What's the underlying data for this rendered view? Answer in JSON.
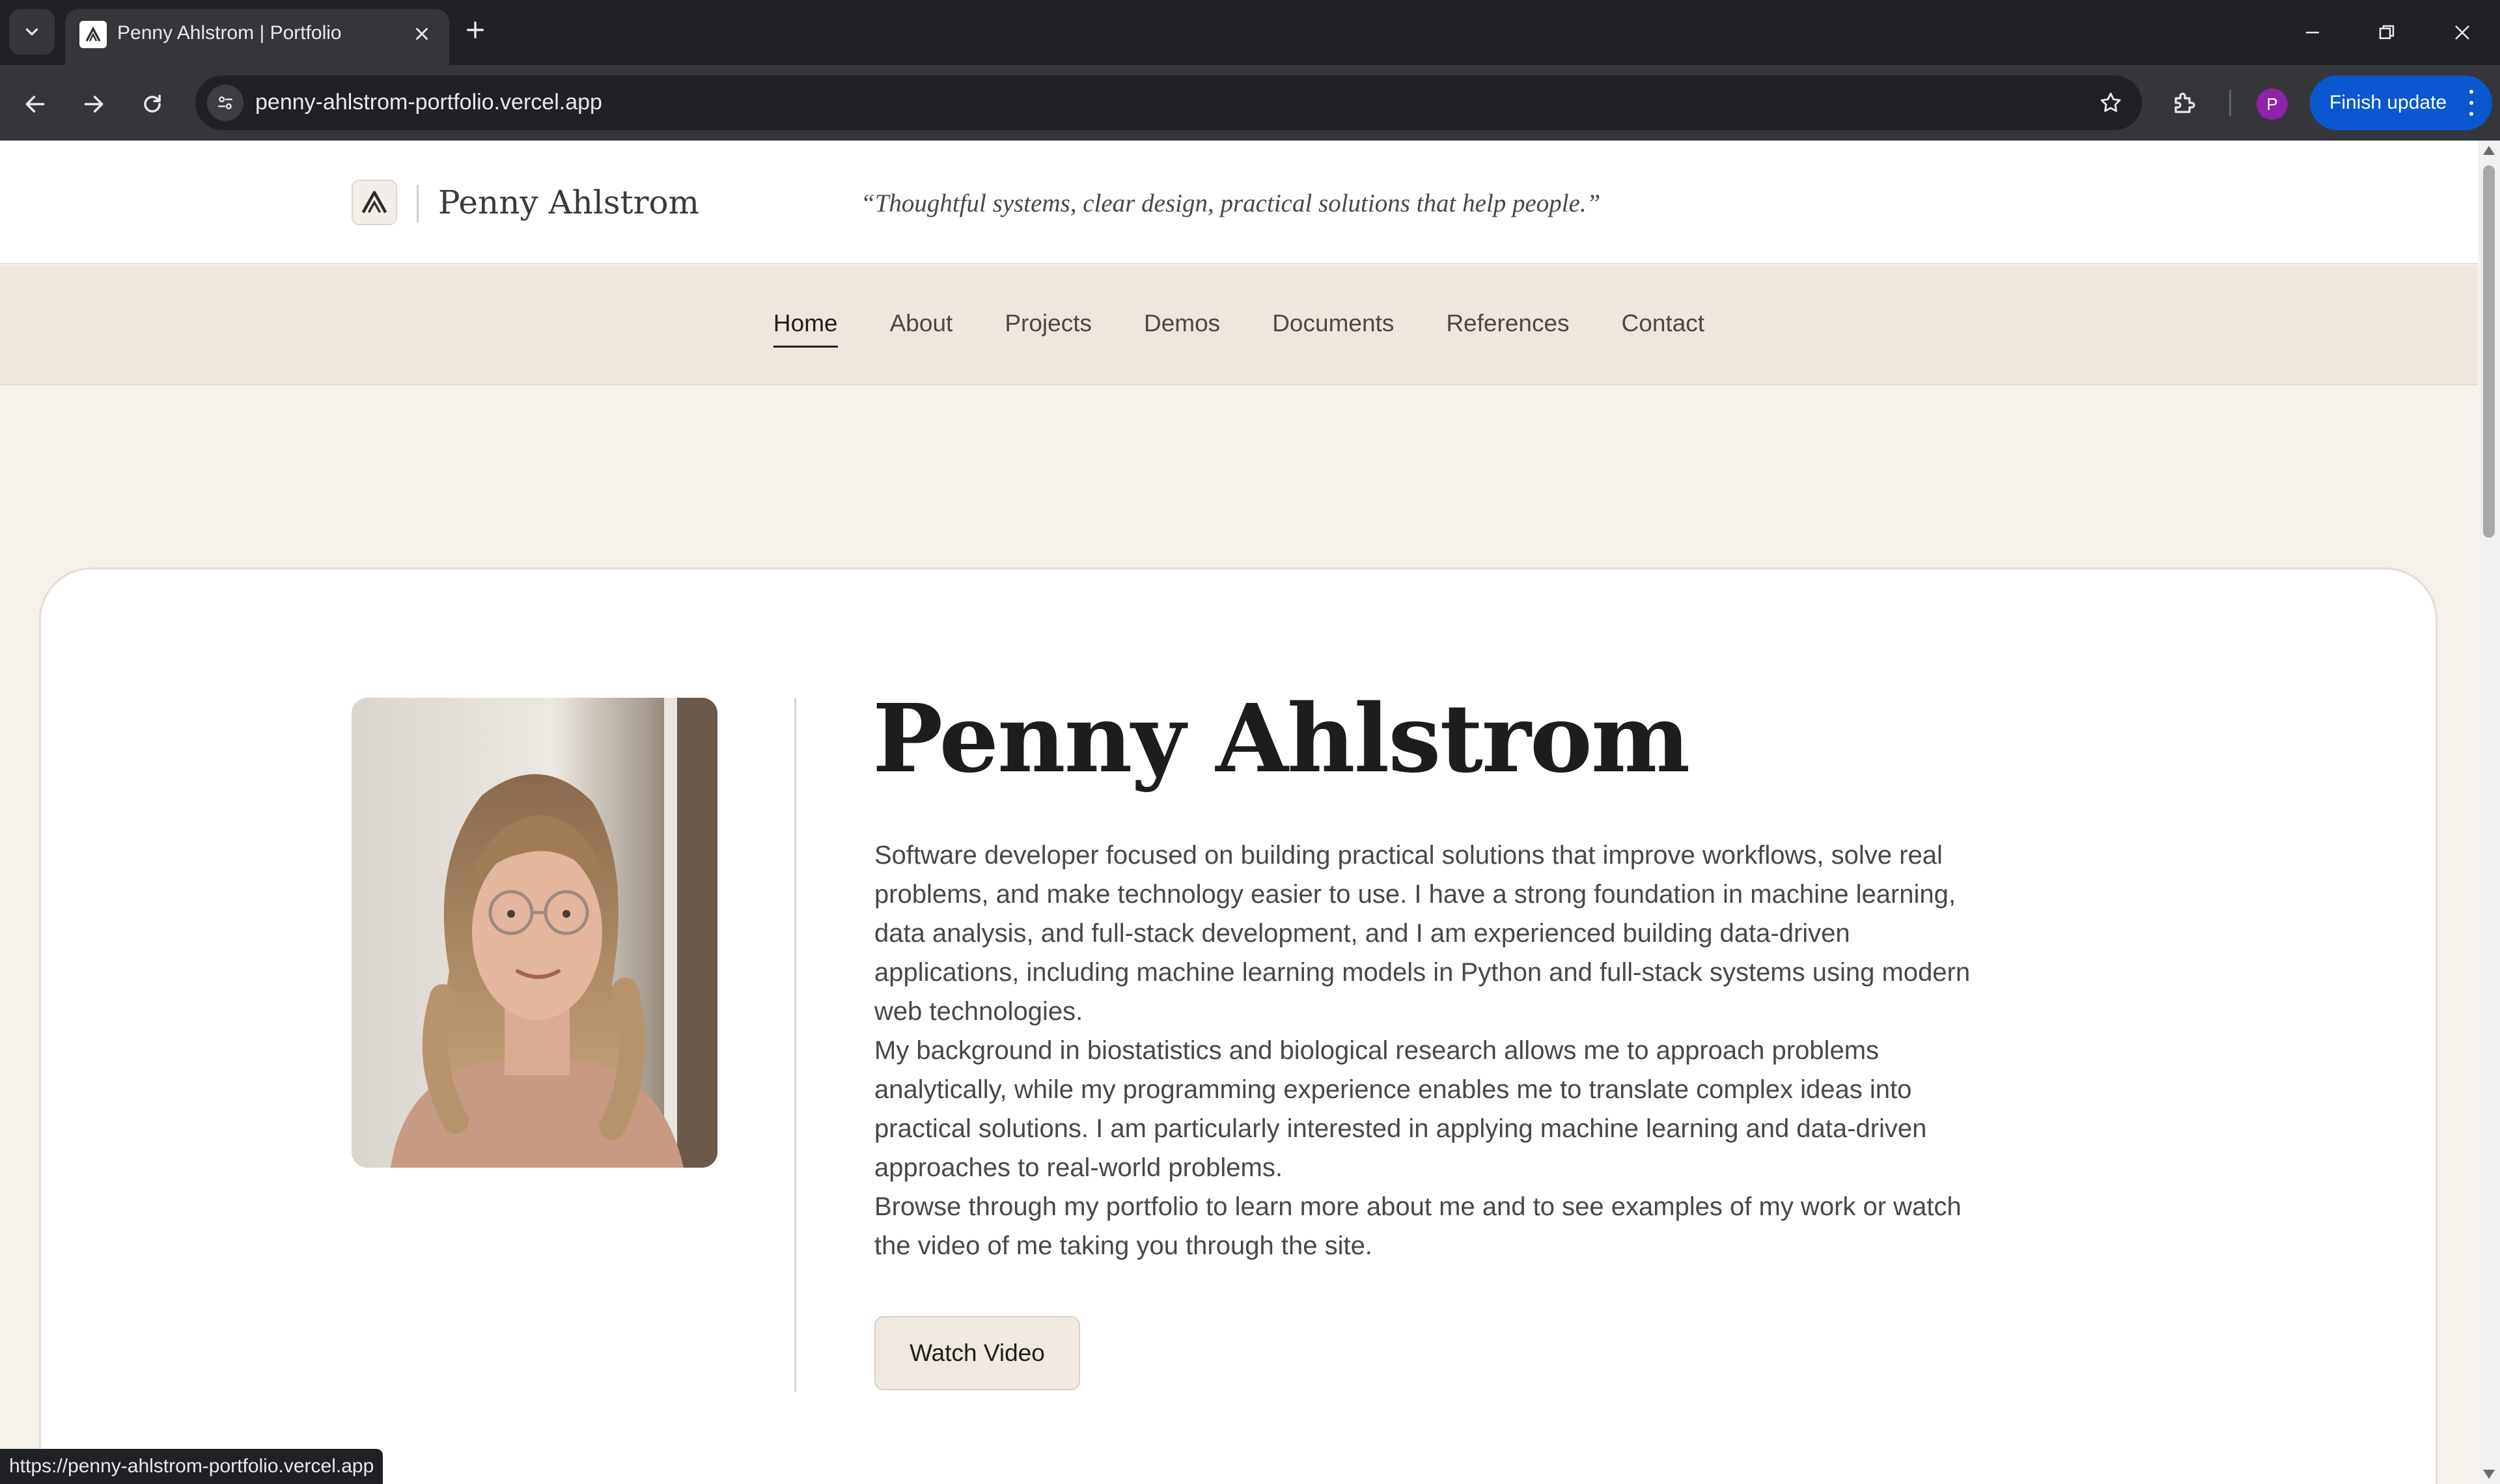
{
  "browser": {
    "tab_title": "Penny Ahlstrom | Portfolio",
    "url": "penny-ahlstrom-portfolio.vercel.app",
    "profile_initial": "P",
    "update_button": "Finish update",
    "status_url": "https://penny-ahlstrom-portfolio.vercel.app"
  },
  "site": {
    "brand_name": "Penny Ahlstrom",
    "tagline": "“Thoughtful systems, clear design, practical solutions that help people.”",
    "nav": [
      {
        "label": "Home",
        "active": true
      },
      {
        "label": "About"
      },
      {
        "label": "Projects"
      },
      {
        "label": "Demos"
      },
      {
        "label": "Documents"
      },
      {
        "label": "References"
      },
      {
        "label": "Contact"
      }
    ]
  },
  "hero": {
    "name": "Penny Ahlstrom",
    "paragraphs": [
      "Software developer focused on building practical solutions that improve workflows, solve real problems, and make technology easier to use. I have a strong foundation in machine learning, data analysis, and full-stack development, and I am experienced building data-driven applications, including machine learning models in Python and full-stack systems using modern web technologies.",
      "My background in biostatistics and biological research allows me to approach problems analytically, while my programming experience enables me to translate complex ideas into practical solutions. I am particularly interested in applying machine learning and data-driven approaches to real-world problems.",
      "Browse through my portfolio to learn more about me and to see examples of my work or watch the video of me taking you through the site."
    ],
    "watch_button": "Watch Video"
  },
  "colors": {
    "accent": "#0b57d0",
    "page_bg": "#f5f1eb",
    "nav_bg": "#efe7dd",
    "text_dark": "#1f1d1b"
  }
}
